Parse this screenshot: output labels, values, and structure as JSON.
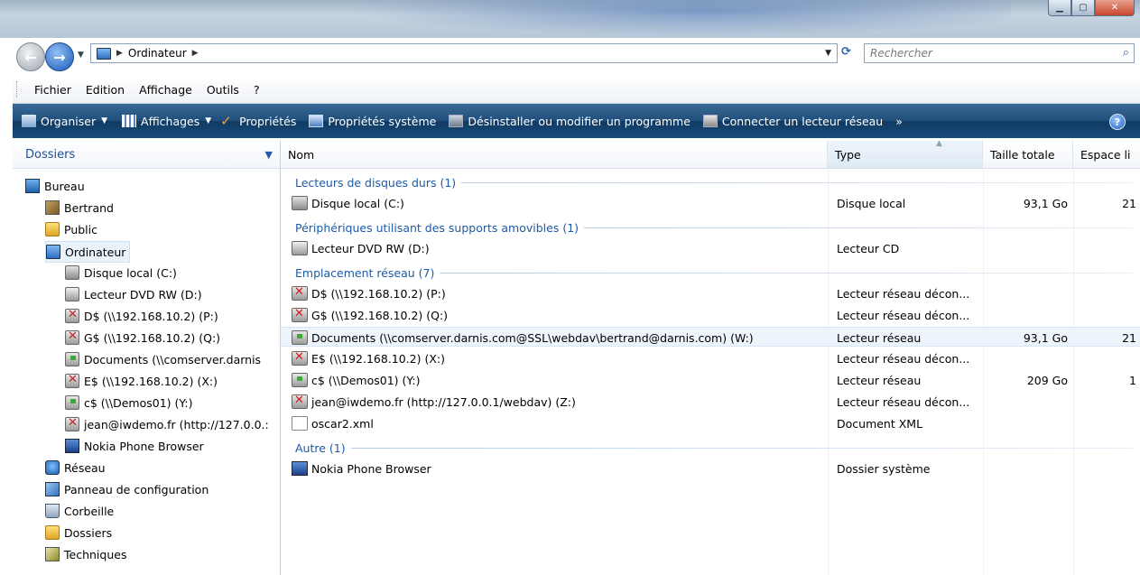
{
  "window": {
    "controls": [
      "minimize",
      "maximize",
      "close"
    ]
  },
  "address": {
    "crumbs": [
      "Ordinateur"
    ],
    "search_placeholder": "Rechercher"
  },
  "menu": [
    "Fichier",
    "Edition",
    "Affichage",
    "Outils",
    "?"
  ],
  "toolbar": {
    "organiser": "Organiser",
    "affichages": "Affichages",
    "proprietes": "Propriétés",
    "proprietes_systeme": "Propriétés système",
    "desinstaller": "Désinstaller ou modifier un programme",
    "connecter": "Connecter un lecteur réseau",
    "more": "»",
    "help": "?"
  },
  "left": {
    "header": "Dossiers",
    "tree": [
      {
        "label": "Bureau",
        "icon": "desktop-icon"
      },
      {
        "label": "Bertrand",
        "icon": "user-folder-icon"
      },
      {
        "label": "Public",
        "icon": "folder-icon"
      },
      {
        "label": "Ordinateur",
        "icon": "computer-icon",
        "selected": true
      },
      {
        "label": "Disque local (C:)",
        "icon": "hard-disk-icon"
      },
      {
        "label": "Lecteur DVD RW (D:)",
        "icon": "dvd-drive-icon"
      },
      {
        "label": "D$ (\\\\192.168.10.2) (P:)",
        "icon": "disconnected-drive-icon"
      },
      {
        "label": "G$ (\\\\192.168.10.2) (Q:)",
        "icon": "disconnected-drive-icon"
      },
      {
        "label": "Documents (\\\\comserver.darnis",
        "icon": "network-drive-icon"
      },
      {
        "label": "E$ (\\\\192.168.10.2) (X:)",
        "icon": "disconnected-drive-icon"
      },
      {
        "label": "c$ (\\\\Demos01) (Y:)",
        "icon": "network-drive-icon"
      },
      {
        "label": "jean@iwdemo.fr (http://127.0.0.:",
        "icon": "disconnected-drive-icon"
      },
      {
        "label": "Nokia Phone Browser",
        "icon": "nokia-icon"
      },
      {
        "label": "Réseau",
        "icon": "network-icon"
      },
      {
        "label": "Panneau de configuration",
        "icon": "control-panel-icon"
      },
      {
        "label": "Corbeille",
        "icon": "recycle-bin-icon"
      },
      {
        "label": "Dossiers",
        "icon": "folder-icon"
      },
      {
        "label": "Techniques",
        "icon": "techniques-icon"
      }
    ]
  },
  "columns": [
    "Nom",
    "Type",
    "Taille totale",
    "Espace li"
  ],
  "groups": [
    {
      "title": "Lecteurs de disques durs (1)",
      "items": [
        {
          "name": "Disque local (C:)",
          "type": "Disque local",
          "size": "93,1 Go",
          "free": "21",
          "icon": "hard-disk-icon"
        }
      ]
    },
    {
      "title": "Périphériques utilisant des supports amovibles (1)",
      "items": [
        {
          "name": "Lecteur DVD RW (D:)",
          "type": "Lecteur CD",
          "size": "",
          "free": "",
          "icon": "dvd-drive-icon"
        }
      ]
    },
    {
      "title": "Emplacement réseau (7)",
      "items": [
        {
          "name": "D$ (\\\\192.168.10.2) (P:)",
          "type": "Lecteur réseau décon...",
          "size": "",
          "free": "",
          "icon": "disconnected-drive-icon"
        },
        {
          "name": "G$ (\\\\192.168.10.2) (Q:)",
          "type": "Lecteur réseau décon...",
          "size": "",
          "free": "",
          "icon": "disconnected-drive-icon"
        },
        {
          "name": "Documents (\\\\comserver.darnis.com@SSL\\webdav\\bertrand@darnis.com) (W:)",
          "type": "Lecteur réseau",
          "size": "93,1 Go",
          "free": "21",
          "icon": "network-drive-icon",
          "highlight": true
        },
        {
          "name": "E$ (\\\\192.168.10.2) (X:)",
          "type": "Lecteur réseau décon...",
          "size": "",
          "free": "",
          "icon": "disconnected-drive-icon"
        },
        {
          "name": "c$ (\\\\Demos01) (Y:)",
          "type": "Lecteur réseau",
          "size": "209 Go",
          "free": "1",
          "icon": "network-drive-icon"
        },
        {
          "name": "jean@iwdemo.fr (http://127.0.0.1/webdav) (Z:)",
          "type": "Lecteur réseau décon...",
          "size": "",
          "free": "",
          "icon": "disconnected-drive-icon"
        },
        {
          "name": "oscar2.xml",
          "type": "Document XML",
          "size": "",
          "free": "",
          "icon": "xml-file-icon"
        }
      ]
    },
    {
      "title": "Autre (1)",
      "items": [
        {
          "name": "Nokia Phone Browser",
          "type": "Dossier système",
          "size": "",
          "free": "",
          "icon": "nokia-icon"
        }
      ]
    }
  ]
}
